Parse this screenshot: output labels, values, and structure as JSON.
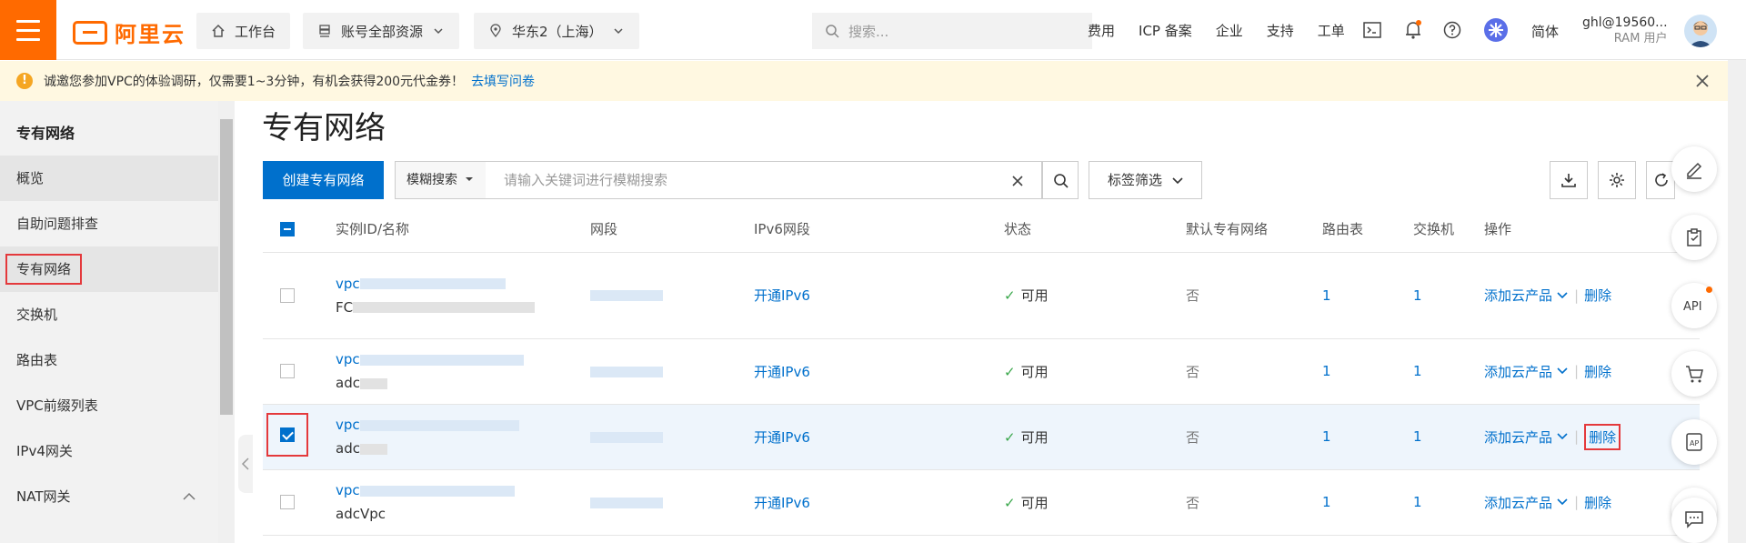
{
  "topbar": {
    "logo_text": "阿里云",
    "workbench": "工作台",
    "resources": "账号全部资源",
    "region": "华东2（上海）",
    "search_placeholder": "搜索...",
    "links": [
      "费用",
      "ICP 备案",
      "企业",
      "支持",
      "工单"
    ],
    "lang": "简体",
    "user_name": "ghl@19560...",
    "user_role": "RAM 用户"
  },
  "notice": {
    "text": "诚邀您参加VPC的体验调研，仅需要1~3分钟，有机会获得200元代金券！",
    "link": "去填写问卷"
  },
  "sidebar": {
    "title": "专有网络",
    "items": [
      {
        "label": "概览"
      },
      {
        "label": "自助问题排查"
      },
      {
        "label": "专有网络"
      },
      {
        "label": "交换机"
      },
      {
        "label": "路由表"
      },
      {
        "label": "VPC前缀列表"
      },
      {
        "label": "IPv4网关"
      },
      {
        "label": "NAT网关"
      }
    ]
  },
  "main": {
    "title": "专有网络",
    "create_button": "创建专有网络",
    "fuzzy_label": "模糊搜索",
    "search_placeholder": "请输入关键词进行模糊搜索",
    "tag_filter": "标签筛选"
  },
  "table": {
    "headers": [
      "实例ID/名称",
      "网段",
      "IPv6网段",
      "状态",
      "默认专有网络",
      "路由表",
      "交换机",
      "操作"
    ],
    "rows": [
      {
        "id_prefix": "vpc",
        "name_prefix": "FC",
        "ipv6": "开通IPv6",
        "status": "可用",
        "default": "否",
        "route_tables": "1",
        "vswitches": "1",
        "add_product": "添加云产品",
        "delete": "删除"
      },
      {
        "id_prefix": "vpc",
        "name_prefix": "adc",
        "ipv6": "开通IPv6",
        "status": "可用",
        "default": "否",
        "route_tables": "1",
        "vswitches": "1",
        "add_product": "添加云产品",
        "delete": "删除"
      },
      {
        "id_prefix": "vpc",
        "name_prefix": "adc",
        "ipv6": "开通IPv6",
        "status": "可用",
        "default": "否",
        "route_tables": "1",
        "vswitches": "1",
        "add_product": "添加云产品",
        "delete": "删除",
        "selected": true
      },
      {
        "id_prefix": "vpc",
        "name_prefix": "adcVpc",
        "ipv6": "开通IPv6",
        "status": "可用",
        "default": "否",
        "route_tables": "1",
        "vswitches": "1",
        "add_product": "添加云产品",
        "delete": "删除"
      }
    ]
  },
  "colors": {
    "brand": "#ff6a00",
    "primary": "#0070cc",
    "highlight": "#e4393c",
    "success": "#3aa74b"
  }
}
